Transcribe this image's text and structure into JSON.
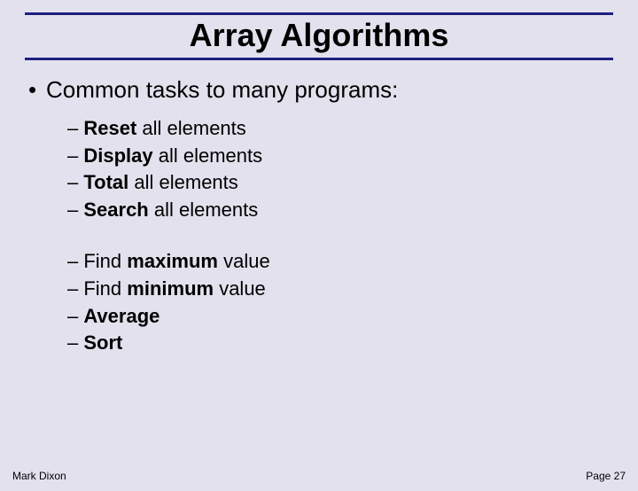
{
  "title": "Array Algorithms",
  "main_bullet": "Common tasks to many programs:",
  "group1": [
    {
      "bold": "Reset",
      "rest": " all elements"
    },
    {
      "bold": "Display",
      "rest": " all elements"
    },
    {
      "bold": "Total",
      "rest": " all elements"
    },
    {
      "bold": "Search",
      "rest": " all elements"
    }
  ],
  "group2": [
    {
      "pre": "Find ",
      "bold": "maximum",
      "rest": " value"
    },
    {
      "pre": "Find ",
      "bold": "minimum",
      "rest": " value"
    },
    {
      "pre": "",
      "bold": "Average",
      "rest": ""
    },
    {
      "pre": "",
      "bold": "Sort",
      "rest": ""
    }
  ],
  "footer": {
    "author": "Mark Dixon",
    "page": "Page 27"
  }
}
